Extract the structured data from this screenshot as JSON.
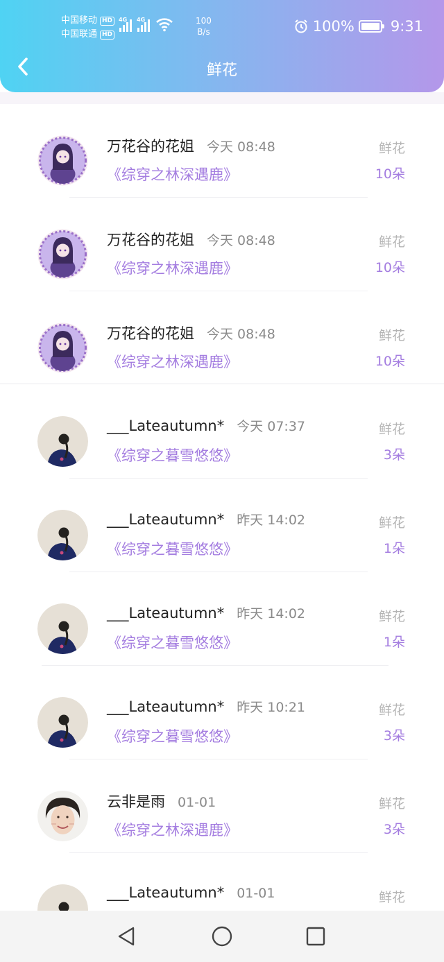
{
  "status_bar": {
    "carrier_1": "中国移动",
    "carrier_2": "中国联通",
    "hd_badge": "HD",
    "net_tag": "4G",
    "net_speed_value": "100",
    "net_speed_unit": "B/s",
    "battery": "100%",
    "time": "9:31"
  },
  "header": {
    "title": "鲜花",
    "back_icon": "chevron-left-icon"
  },
  "colors": {
    "accent": "#a47de0",
    "header_start": "#4fd3f3",
    "header_end": "#b497ea"
  },
  "records": [
    {
      "name": "万花谷的花姐",
      "time": "今天 08:48",
      "book": "《综穿之林深遇鹿》",
      "kind": "鲜花",
      "count": "10朵",
      "avatar": "anime-avatar"
    },
    {
      "name": "万花谷的花姐",
      "time": "今天 08:48",
      "book": "《综穿之林深遇鹿》",
      "kind": "鲜花",
      "count": "10朵",
      "avatar": "anime-avatar"
    },
    {
      "name": "万花谷的花姐",
      "time": "今天 08:48",
      "book": "《综穿之林深遇鹿》",
      "kind": "鲜花",
      "count": "10朵",
      "avatar": "anime-avatar"
    },
    {
      "name": "___Lateautumn*",
      "time": "今天 07:37",
      "book": "《综穿之暮雪悠悠》",
      "kind": "鲜花",
      "count": "3朵",
      "avatar": "braid-avatar"
    },
    {
      "name": "___Lateautumn*",
      "time": "昨天 14:02",
      "book": "《综穿之暮雪悠悠》",
      "kind": "鲜花",
      "count": "1朵",
      "avatar": "braid-avatar"
    },
    {
      "name": "___Lateautumn*",
      "time": "昨天 14:02",
      "book": "《综穿之暮雪悠悠》",
      "kind": "鲜花",
      "count": "1朵",
      "avatar": "braid-avatar"
    },
    {
      "name": "___Lateautumn*",
      "time": "昨天 10:21",
      "book": "《综穿之暮雪悠悠》",
      "kind": "鲜花",
      "count": "3朵",
      "avatar": "braid-avatar"
    },
    {
      "name": "云非是雨",
      "time": "01-01",
      "book": "《综穿之林深遇鹿》",
      "kind": "鲜花",
      "count": "3朵",
      "avatar": "face-avatar"
    },
    {
      "name": "___Lateautumn*",
      "time": "01-01",
      "book": "",
      "kind": "鲜花",
      "count": "",
      "avatar": "braid-avatar"
    }
  ],
  "nav_bar": {
    "back_icon": "triangle-back-icon",
    "home_icon": "circle-home-icon",
    "recents_icon": "square-recents-icon"
  }
}
